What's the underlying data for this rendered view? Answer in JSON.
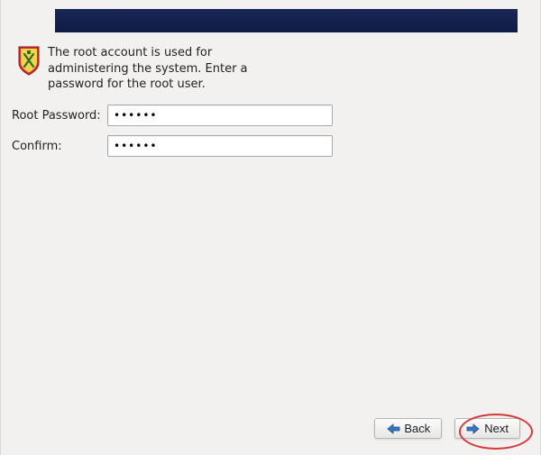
{
  "header": {
    "title": ""
  },
  "intro": {
    "text": "The root account is used for administering the system.  Enter a password for the root user."
  },
  "form": {
    "root_password_label": "Root Password:",
    "confirm_label": "Confirm:",
    "root_password_value": "••••••",
    "confirm_value": "••••••"
  },
  "buttons": {
    "back_label": "Back",
    "next_label": "Next"
  }
}
